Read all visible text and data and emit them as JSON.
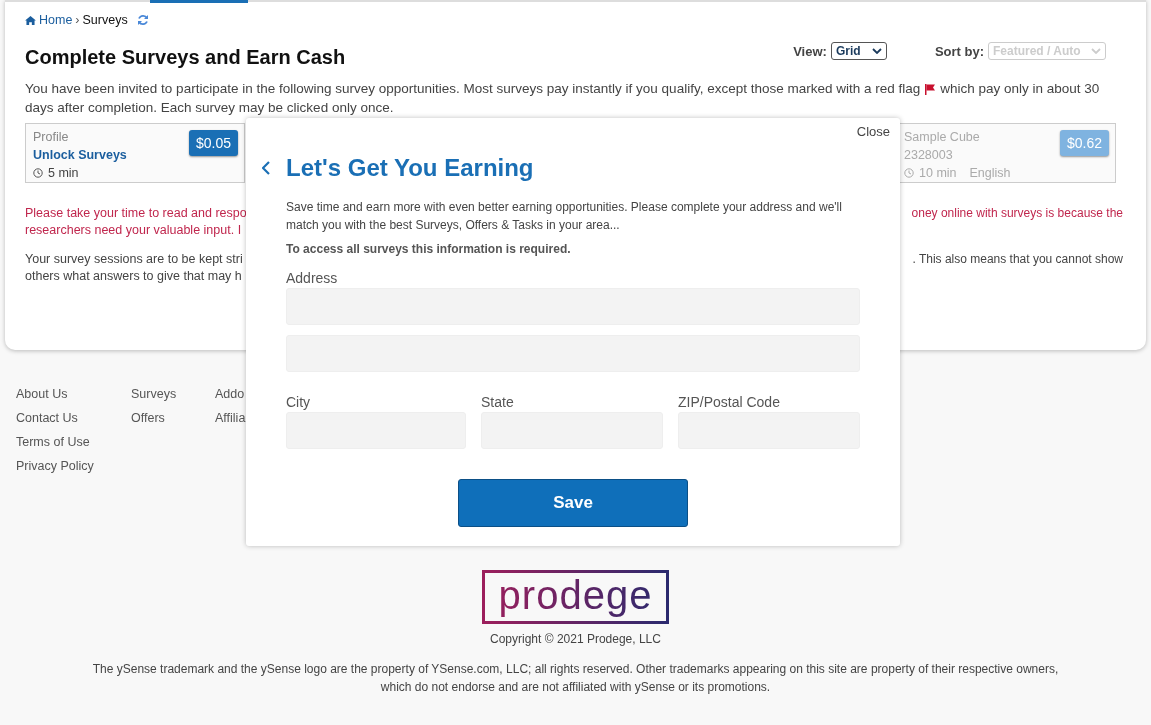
{
  "breadcrumb": [
    {
      "label": "Home",
      "kind": "link"
    },
    {
      "label": "›",
      "kind": "separator"
    },
    {
      "label": "Surveys",
      "kind": "current"
    }
  ],
  "page_title": "Complete Surveys and Earn Cash",
  "view": {
    "label": "View:",
    "value": "Grid",
    "disabled": false
  },
  "sort": {
    "label": "Sort by:",
    "value": "Featured / Auto",
    "disabled": true
  },
  "intro": {
    "before_flag": "You have been invited to participate in the following survey opportunities. Most surveys pay instantly if you qualify, except those marked with a red flag",
    "after_flag": "which pay only in about 30",
    "continuation": "days after completion. Each survey may be clicked only once."
  },
  "surveys": [
    {
      "category": "Profile",
      "title": "Unlock Surveys",
      "duration": "5 min",
      "price": "$0.05",
      "disabled": false
    },
    {
      "category": "Sample Cube",
      "title": "2328003",
      "duration": "10 min",
      "language": "English",
      "price": "$0.62",
      "disabled": true
    }
  ],
  "notices": [
    {
      "kind": "warning",
      "left": [
        "Please take your time to read and respo",
        "researchers need your valuable input. I"
      ],
      "right": [
        "oney online with surveys is because the"
      ]
    },
    {
      "kind": "info",
      "left": [
        "Your survey sessions are to be kept stri",
        "others what answers to give that may h"
      ],
      "right": [
        ". This also means that you cannot show"
      ]
    }
  ],
  "footer_links": [
    [
      "About Us",
      "Contact Us",
      "Terms of Use",
      "Privacy Policy"
    ],
    [
      "Surveys",
      "Offers"
    ],
    [
      "Addo",
      "Affilia"
    ]
  ],
  "modal": {
    "close": "Close",
    "title": "Let's Get You Earning",
    "description": "Save time and earn more with even better earning opportunities. Please complete your address and we'll match you with the best Surveys, Offers & Tasks in your area...",
    "note": "To access all surveys this information is required.",
    "address_label": "Address",
    "fields": [
      {
        "label": "City"
      },
      {
        "label": "State"
      },
      {
        "label": "ZIP/Postal Code"
      }
    ],
    "save": "Save"
  },
  "footer": {
    "logo": "prodege",
    "copyright": "Copyright © 2021 Prodege, LLC",
    "trademark": "The ySense trademark and the ySense logo are the property of YSense.com, LLC; all rights reserved. Other trademarks appearing on this site are property of their respective owners, which do not endorse and are not affiliated with ySense or its promotions."
  }
}
